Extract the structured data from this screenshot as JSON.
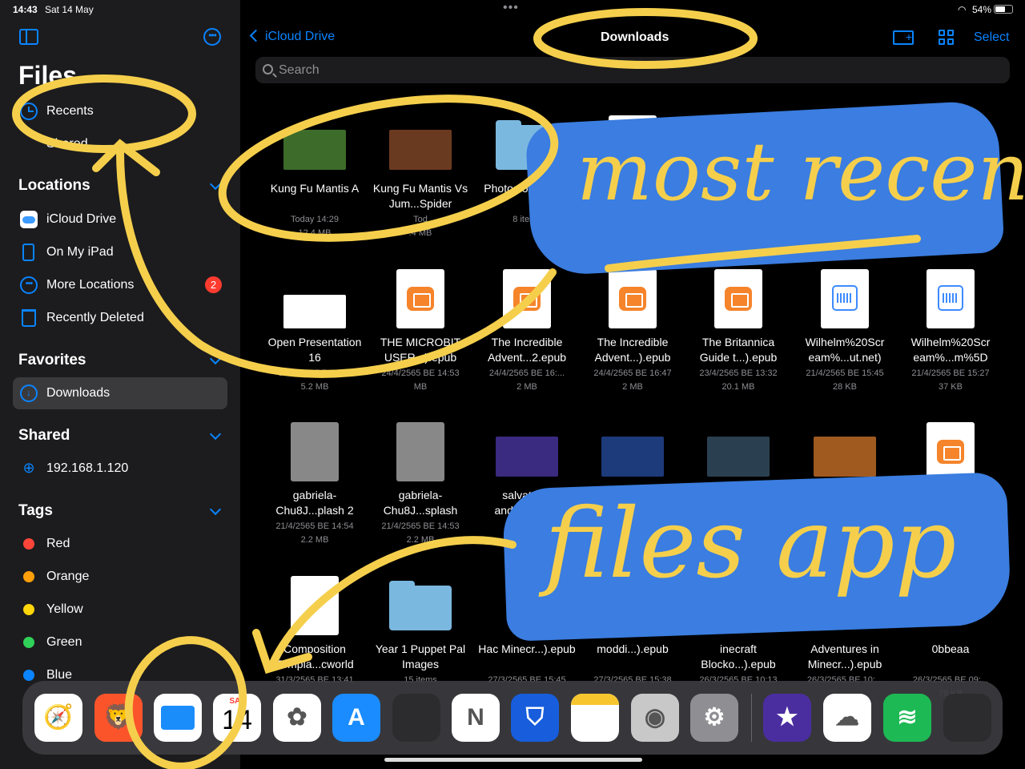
{
  "status": {
    "time": "14:43",
    "date": "Sat 14 May",
    "battery": "54%"
  },
  "sidebar": {
    "title": "Files",
    "recents": "Recents",
    "shared_peek": "Shared",
    "locations_header": "Locations",
    "locations": [
      {
        "label": "iCloud Drive",
        "icon": "icloud-icon"
      },
      {
        "label": "On My iPad",
        "icon": "ipad-icon"
      },
      {
        "label": "More Locations",
        "icon": "more-locations-icon",
        "badge": "2"
      },
      {
        "label": "Recently Deleted",
        "icon": "trash-icon"
      }
    ],
    "favorites_header": "Favorites",
    "favorites": [
      {
        "label": "Downloads",
        "icon": "download-icon"
      }
    ],
    "shared_header": "Shared",
    "shared": [
      {
        "label": "192.168.1.120",
        "icon": "globe-icon"
      }
    ],
    "tags_header": "Tags",
    "tags": [
      {
        "label": "Red",
        "color": "#ff453a"
      },
      {
        "label": "Orange",
        "color": "#ff9f0a"
      },
      {
        "label": "Yellow",
        "color": "#ffd60a"
      },
      {
        "label": "Green",
        "color": "#30d158"
      },
      {
        "label": "Blue",
        "color": "#0a84ff"
      }
    ]
  },
  "navbar": {
    "back": "iCloud Drive",
    "title": "Downloads",
    "select": "Select"
  },
  "search": {
    "placeholder": "Search"
  },
  "files": [
    {
      "name": "Kung Fu Mantis A",
      "meta1": "Today 14:29",
      "meta2": "12.4 MB",
      "kind": "photo",
      "color": "#3c6b2a"
    },
    {
      "name": "Kung Fu Mantis Vs Jum...Spider",
      "meta1": "Tod",
      "meta2": ".4 MB",
      "kind": "photo",
      "color": "#6a3a20"
    },
    {
      "name": "Photos of Patana",
      "meta1": "8 items",
      "meta2": "",
      "kind": "folder"
    },
    {
      "name": "",
      "meta1": "",
      "meta2": "",
      "kind": "doc"
    },
    {
      "name": "",
      "meta1": "",
      "meta2": "",
      "kind": "doc"
    },
    {
      "name": "",
      "meta1": "",
      "meta2": "",
      "kind": "doc"
    },
    {
      "name": "",
      "meta1": "",
      "meta2": "",
      "kind": "doc"
    },
    {
      "name": "Open Presentation 16",
      "meta1": "3/5/2565 BE 10:07",
      "meta2": "5.2 MB",
      "kind": "pres"
    },
    {
      "name": "THE MICROBIT USER...).epub",
      "meta1": "24/4/2565 BE 14:53",
      "meta2": "MB",
      "kind": "epub"
    },
    {
      "name": "The Incredible Advent...2.epub",
      "meta1": "24/4/2565 BE 16:...",
      "meta2": "2 MB",
      "kind": "epub"
    },
    {
      "name": "The Incredible Advent...).epub",
      "meta1": "24/4/2565 BE 16:47",
      "meta2": "2 MB",
      "kind": "epub"
    },
    {
      "name": "The Britannica Guide t...).epub",
      "meta1": "23/4/2565 BE 13:32",
      "meta2": "20.1 MB",
      "kind": "epub"
    },
    {
      "name": "Wilhelm%20Scr eam%...ut.net)",
      "meta1": "21/4/2565 BE 15:45",
      "meta2": "28 KB",
      "kind": "audio"
    },
    {
      "name": "Wilhelm%20Scr eam%...m%5D",
      "meta1": "21/4/2565 BE 15:27",
      "meta2": "37 KB",
      "kind": "audio"
    },
    {
      "name": "gabriela-Chu8J...plash 2",
      "meta1": "21/4/2565 BE 14:54",
      "meta2": "2.2 MB",
      "kind": "photo-tall",
      "color": "#888888"
    },
    {
      "name": "gabriela-Chu8J...splash",
      "meta1": "21/4/2565 BE 14:53",
      "meta2": "2.2 MB",
      "kind": "photo-tall",
      "color": "#888888"
    },
    {
      "name": "salvatore-andrea...spla",
      "meta1": "20/4/2565",
      "meta2": "40",
      "kind": "photo",
      "color": "#3a2a80"
    },
    {
      "name": "",
      "meta1": "",
      "meta2": "",
      "kind": "photo",
      "color": "#1d3a7a"
    },
    {
      "name": "",
      "meta1": "",
      "meta2": "",
      "kind": "photo",
      "color": "#2a4050"
    },
    {
      "name": "",
      "meta1": "",
      "meta2": "",
      "kind": "photo",
      "color": "#a05a20"
    },
    {
      "name": "",
      "meta1": "",
      "meta2": "",
      "kind": "epub"
    },
    {
      "name": "Composition Templa...cworld",
      "meta1": "31/3/2565 BE 13:41",
      "meta2": "",
      "kind": "doc"
    },
    {
      "name": "Year 1 Puppet Pal Images",
      "meta1": "15 items",
      "meta2": "",
      "kind": "folder"
    },
    {
      "name": "Hac Minecr...).epub",
      "meta1": "27/3/2565 BE 15:45",
      "meta2": "",
      "kind": "none"
    },
    {
      "name": "moddi...).epub",
      "meta1": "27/3/2565 BE 15:38",
      "meta2": "",
      "kind": "none"
    },
    {
      "name": "inecraft Blocko...).epub",
      "meta1": "26/3/2565 BE 10:13",
      "meta2": "",
      "kind": "none"
    },
    {
      "name": "Adventures in Minecr...).epub",
      "meta1": "26/3/2565 BE 10:...",
      "meta2": "",
      "kind": "none"
    },
    {
      "name": "0bbeaa",
      "meta1": "26/3/2565 BE 09:...",
      "meta2": "79 KB",
      "kind": "none"
    }
  ],
  "dock": [
    {
      "name": "safari-app-icon",
      "color": "#ffffff",
      "glyph": "🧭"
    },
    {
      "name": "brave-app-icon",
      "color": "#fb542b",
      "glyph": "🦁"
    },
    {
      "name": "files-app-icon",
      "color": "#ffffff",
      "glyph": ""
    },
    {
      "name": "calendar-app-icon",
      "color": "#ffffff",
      "glyph": ""
    },
    {
      "name": "photos-app-icon",
      "color": "#ffffff",
      "glyph": "✿"
    },
    {
      "name": "app-store-icon",
      "color": "#1a8cff",
      "glyph": "A"
    },
    {
      "name": "app-folder-icon",
      "color": "#2c2c2e",
      "glyph": ""
    },
    {
      "name": "onenote-app-icon",
      "color": "#ffffff",
      "glyph": "N"
    },
    {
      "name": "bitwarden-app-icon",
      "color": "#175ddc",
      "glyph": "⛉"
    },
    {
      "name": "notes-app-icon",
      "color": "#ffffff",
      "glyph": ""
    },
    {
      "name": "camera-app-icon",
      "color": "#c8c8c8",
      "glyph": "◉"
    },
    {
      "name": "settings-app-icon",
      "color": "#8e8e93",
      "glyph": "⚙"
    },
    {
      "name": "imovie-app-icon",
      "color": "#4a2ea0",
      "glyph": "★"
    },
    {
      "name": "onedrive-app-icon",
      "color": "#ffffff",
      "glyph": "☁"
    },
    {
      "name": "spotify-app-icon",
      "color": "#1db954",
      "glyph": "≋"
    },
    {
      "name": "recent-apps-icon",
      "color": "#2c2c2e",
      "glyph": ""
    }
  ],
  "dock_calendar": {
    "day": "SAT",
    "num": "14"
  },
  "annotations": {
    "top_text": "most recent",
    "bottom_text": "files app",
    "ink": "#f5cf4c",
    "brush": "#3b7de0"
  }
}
